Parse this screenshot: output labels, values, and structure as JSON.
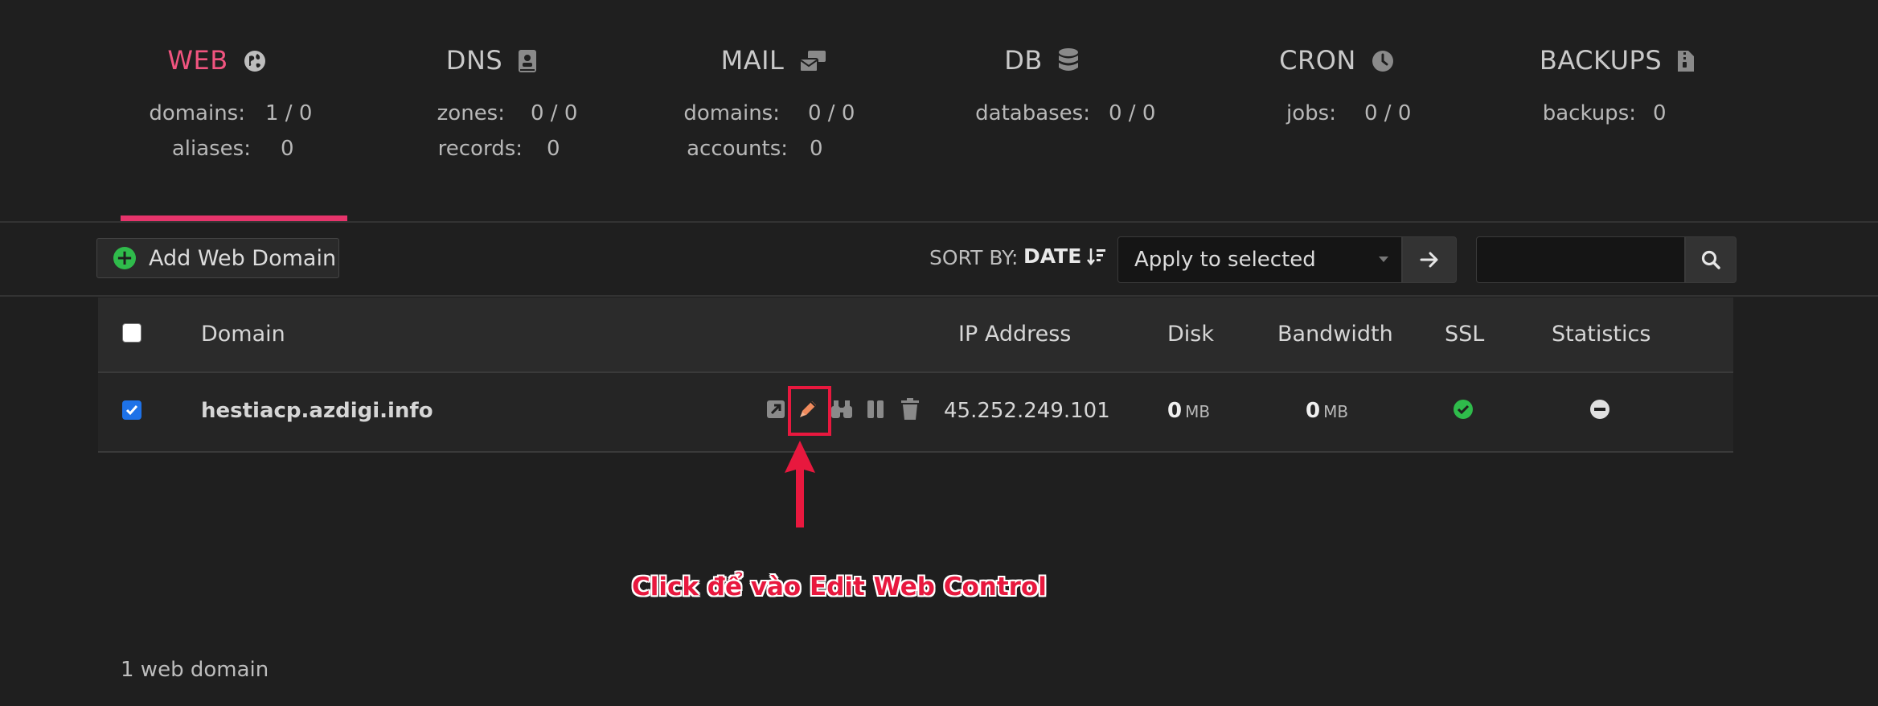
{
  "stats": [
    {
      "id": "web",
      "title": "WEB",
      "icon": "globe-icon",
      "active": true,
      "rows": [
        {
          "label": "domains:",
          "value": "1 / 0"
        },
        {
          "label": "aliases:",
          "value": "0"
        }
      ]
    },
    {
      "id": "dns",
      "title": "DNS",
      "icon": "address-book-icon",
      "active": false,
      "rows": [
        {
          "label": "zones:",
          "value": "0 / 0"
        },
        {
          "label": "records:",
          "value": "0"
        }
      ]
    },
    {
      "id": "mail",
      "title": "MAIL",
      "icon": "mail-bulk-icon",
      "active": false,
      "rows": [
        {
          "label": "domains:",
          "value": "0 / 0"
        },
        {
          "label": "accounts:",
          "value": "0"
        }
      ]
    },
    {
      "id": "db",
      "title": "DB",
      "icon": "database-icon",
      "active": false,
      "rows": [
        {
          "label": "databases:",
          "value": "0 / 0"
        }
      ]
    },
    {
      "id": "cron",
      "title": "CRON",
      "icon": "clock-icon",
      "active": false,
      "rows": [
        {
          "label": "jobs:",
          "value": "0 / 0"
        }
      ]
    },
    {
      "id": "backups",
      "title": "BACKUPS",
      "icon": "file-archive-icon",
      "active": false,
      "rows": [
        {
          "label": "backups:",
          "value": "0"
        }
      ]
    }
  ],
  "toolbar": {
    "add_label": "Add Web Domain",
    "sort_label": "SORT BY:",
    "sort_value": "DATE",
    "bulk_select": "Apply to selected",
    "search_placeholder": ""
  },
  "table": {
    "columns": {
      "domain": "Domain",
      "ip": "IP Address",
      "disk": "Disk",
      "bandwidth": "Bandwidth",
      "ssl": "SSL",
      "statistics": "Statistics"
    },
    "rows": [
      {
        "domain": "hestiacp.azdigi.info",
        "ip": "45.252.249.101",
        "disk_value": "0",
        "disk_unit": "MB",
        "bandwidth_value": "0",
        "bandwidth_unit": "MB",
        "ssl": "enabled",
        "statistics": "disabled",
        "checked": true
      }
    ]
  },
  "annotation": "Click để vào Edit Web Control",
  "footer": {
    "count_text": "1 web domain"
  },
  "colors": {
    "accent": "#e6346b",
    "annotation": "#e8183e",
    "ssl_ok": "#2fbb4b",
    "checkbox": "#1e72e8"
  }
}
